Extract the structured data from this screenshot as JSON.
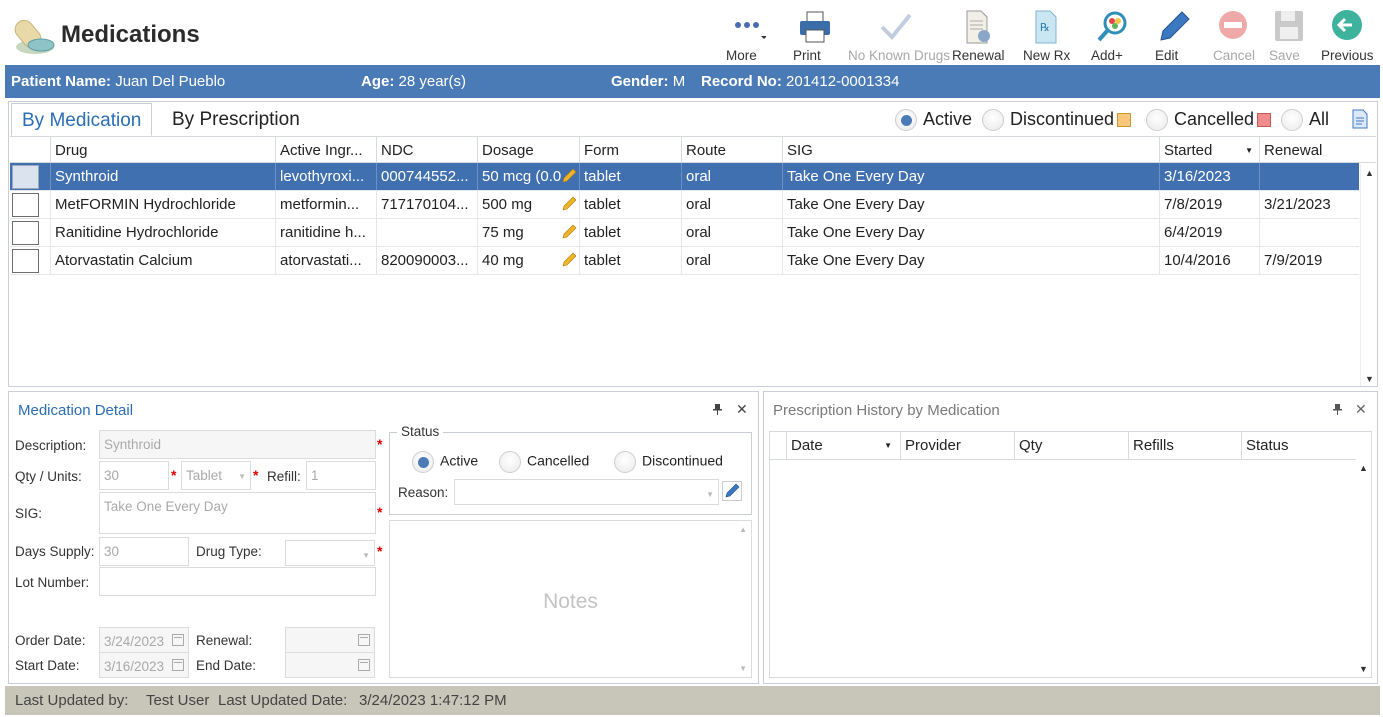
{
  "app": {
    "title": "Medications",
    "icon": "pill-icon"
  },
  "toolbar": [
    {
      "name": "more",
      "label": "More",
      "icon": "more-icon",
      "enabled": true
    },
    {
      "name": "print",
      "label": "Print",
      "icon": "printer-icon",
      "enabled": true
    },
    {
      "name": "no-known-drugs",
      "label": "No Known Drugs",
      "icon": "checkmark-icon",
      "enabled": false
    },
    {
      "name": "renewal",
      "label": "Renewal",
      "icon": "document-renew-icon",
      "enabled": true
    },
    {
      "name": "new-rx",
      "label": "New Rx",
      "icon": "new-rx-icon",
      "enabled": true
    },
    {
      "name": "add-plus",
      "label": "Add+",
      "icon": "magnifier-add-icon",
      "enabled": true
    },
    {
      "name": "edit",
      "label": "Edit",
      "icon": "pencil-icon",
      "enabled": true
    },
    {
      "name": "cancel",
      "label": "Cancel",
      "icon": "cancel-icon",
      "enabled": false
    },
    {
      "name": "save",
      "label": "Save",
      "icon": "floppy-icon",
      "enabled": false
    },
    {
      "name": "previous",
      "label": "Previous",
      "icon": "arrow-left-icon",
      "enabled": true
    }
  ],
  "patient": {
    "name_label": "Patient Name:",
    "name": "Juan Del Pueblo",
    "age_label": "Age:",
    "age": "28 year(s)",
    "gender_label": "Gender:",
    "gender": "M",
    "record_label": "Record No:",
    "record": "201412-0001334"
  },
  "tabs": {
    "by_medication": "By Medication",
    "by_prescription": "By Prescription"
  },
  "filters": {
    "active": "Active",
    "discontinued": "Discontinued",
    "cancelled": "Cancelled",
    "all": "All",
    "selected": "active",
    "discontinued_color": "#f7c87a",
    "cancelled_color": "#f08c8c"
  },
  "med_grid": {
    "columns": [
      "Drug",
      "Active Ingr...",
      "NDC",
      "Dosage",
      "Form",
      "Route",
      "SIG",
      "Started",
      "Renewal"
    ],
    "sort_column": "Started",
    "rows": [
      {
        "drug": "Synthroid",
        "ingredient": "levothyroxi...",
        "ndc": "000744552...",
        "dosage": "50 mcg (0.0",
        "form": "tablet",
        "route": "oral",
        "sig": "Take One Every Day",
        "started": "3/16/2023",
        "renewal": "",
        "selected": true
      },
      {
        "drug": "MetFORMIN Hydrochloride",
        "ingredient": "metformin...",
        "ndc": "717170104...",
        "dosage": "500 mg",
        "form": "tablet",
        "route": "oral",
        "sig": "Take One Every Day",
        "started": "7/8/2019",
        "renewal": "3/21/2023",
        "selected": false
      },
      {
        "drug": "Ranitidine Hydrochloride",
        "ingredient": "ranitidine h...",
        "ndc": "",
        "dosage": "75 mg",
        "form": "tablet",
        "route": "oral",
        "sig": "Take One Every Day",
        "started": "6/4/2019",
        "renewal": "",
        "selected": false
      },
      {
        "drug": "Atorvastatin Calcium",
        "ingredient": "atorvastati...",
        "ndc": "820090003...",
        "dosage": "40 mg",
        "form": "tablet",
        "route": "oral",
        "sig": "Take One Every Day",
        "started": "10/4/2016",
        "renewal": "7/9/2019",
        "selected": false
      }
    ]
  },
  "detail": {
    "title": "Medication Detail",
    "description_label": "Description:",
    "description": "Synthroid",
    "qty_label": "Qty / Units:",
    "qty": "30",
    "units": "Tablet",
    "refill_label": "Refill:",
    "refill": "1",
    "sig_label": "SIG:",
    "sig": "Take One Every Day",
    "days_supply_label": "Days Supply:",
    "days_supply": "30",
    "drug_type_label": "Drug Type:",
    "drug_type": "",
    "lot_label": "Lot Number:",
    "lot": "",
    "order_date_label": "Order Date:",
    "order_date": "3/24/2023",
    "renewal_label": "Renewal:",
    "renewal": "",
    "start_date_label": "Start Date:",
    "start_date": "3/16/2023",
    "end_date_label": "End Date:",
    "end_date": "",
    "status_legend": "Status",
    "status_active": "Active",
    "status_cancelled": "Cancelled",
    "status_discontinued": "Discontinued",
    "status_selected": "active",
    "reason_label": "Reason:",
    "reason": "",
    "notes_placeholder": "Notes"
  },
  "history": {
    "title": "Prescription History by Medication",
    "columns": [
      "Date",
      "Provider",
      "Qty",
      "Refills",
      "Status"
    ]
  },
  "footer": {
    "updated_by_label": "Last Updated by:",
    "updated_by": "Test User",
    "updated_date_label": "Last Updated Date:",
    "updated_date": "3/24/2023 1:47:12 PM"
  }
}
